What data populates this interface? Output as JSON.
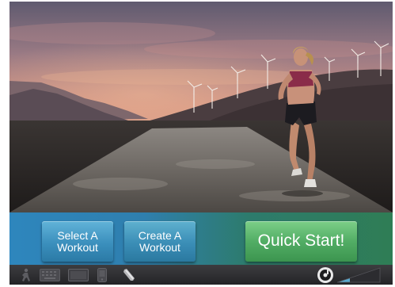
{
  "actions": {
    "select_workout": "Select A\nWorkout",
    "create_workout": "Create A\nWorkout",
    "quick_start": "Quick Start!"
  },
  "status_bar": {
    "icons": [
      "runner-icon",
      "keyboard-icon",
      "tv-icon",
      "phone-icon",
      "key-icon",
      "music-player-icon",
      "volume-level-icon"
    ]
  },
  "colors": {
    "select_button": "#3b8fbd",
    "create_button": "#3a8db6",
    "quick_start_button": "#52ad65",
    "action_bar_left": "#2e86bd",
    "action_bar_right": "#2f7d55"
  }
}
